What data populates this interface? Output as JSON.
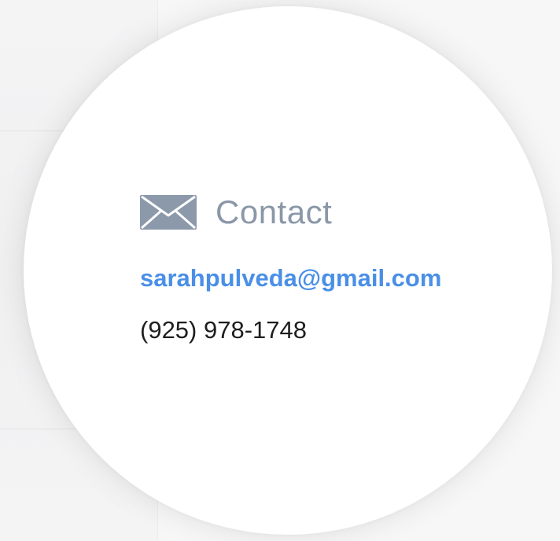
{
  "contact": {
    "icon": "envelope-icon",
    "title": "Contact",
    "email": "sarahpulveda@gmail.com",
    "phone": "(925) 978-1748"
  },
  "colors": {
    "title": "#8a97a8",
    "icon": "#8b99ab",
    "email_link": "#4a8fe7",
    "phone_text": "#1e1e1e",
    "card_background": "#ffffff",
    "page_background": "#f3f3f4"
  }
}
